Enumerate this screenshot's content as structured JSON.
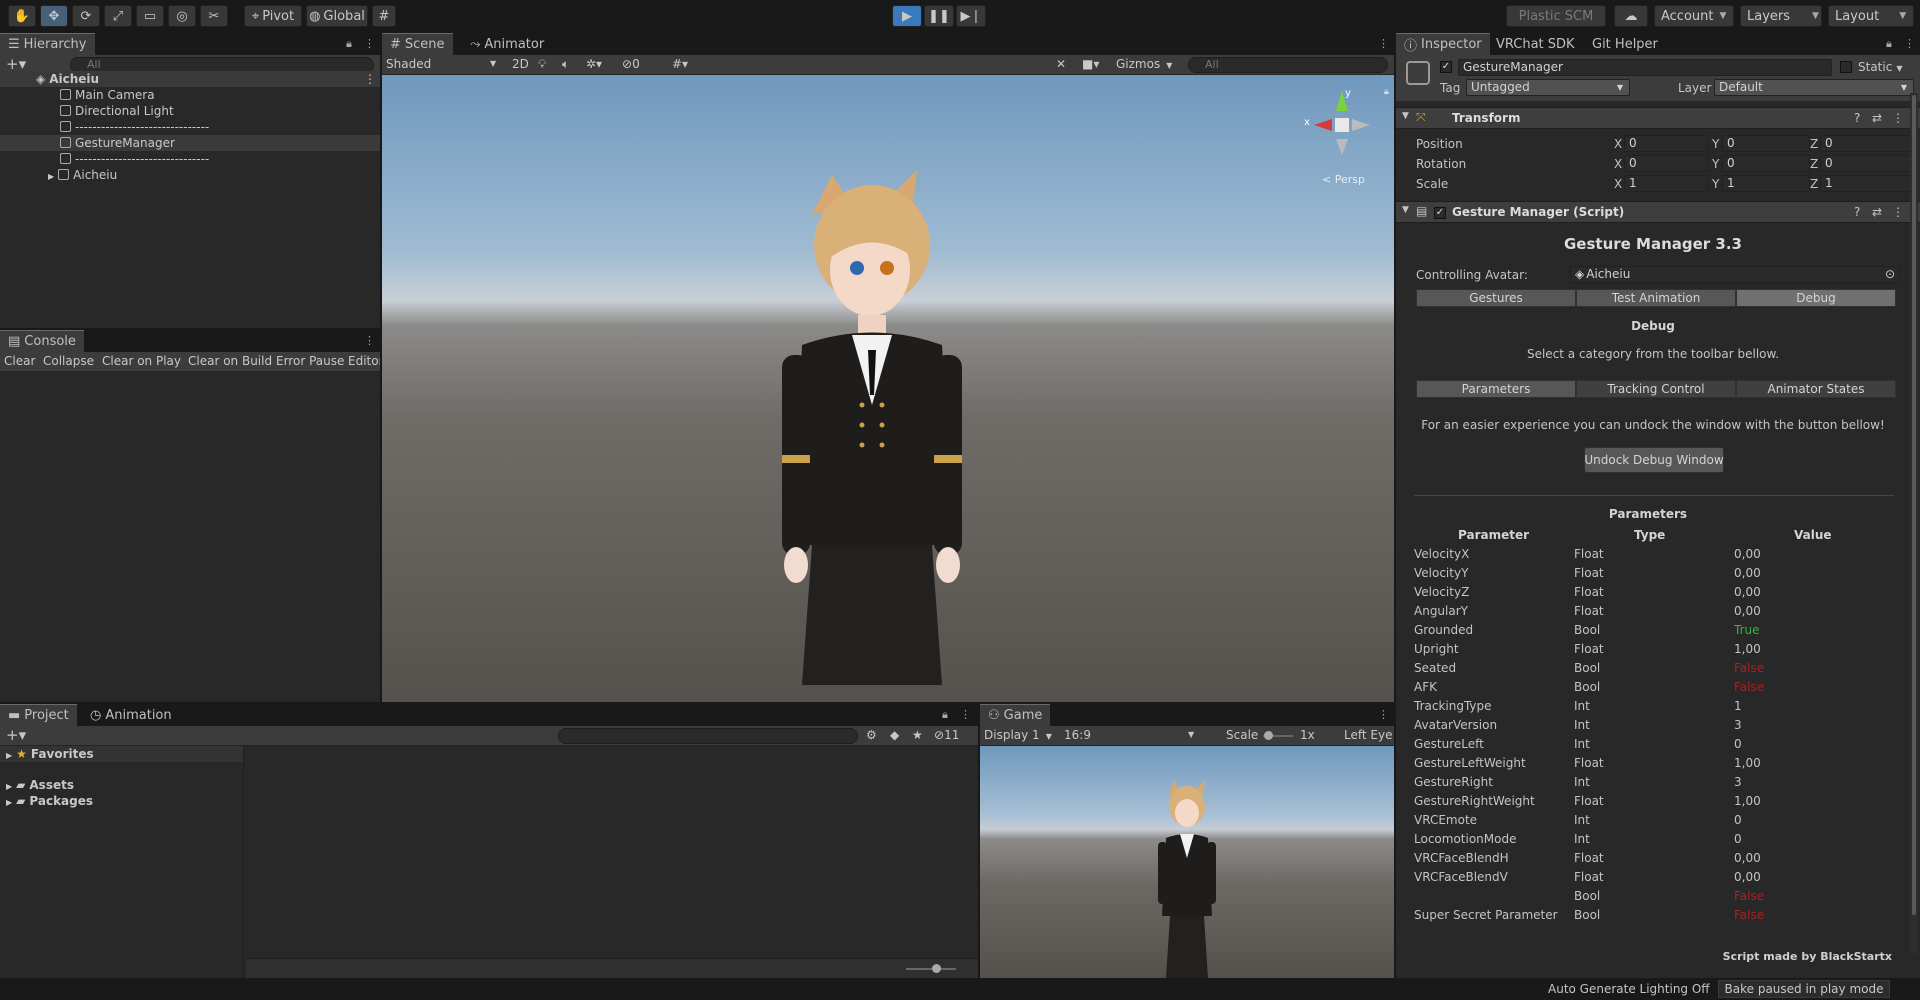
{
  "toolbar": {
    "pivot": "Pivot",
    "global": "Global",
    "plastic": "Plastic SCM",
    "account": "Account",
    "layers": "Layers",
    "layout": "Layout"
  },
  "hierarchy": {
    "tab": "Hierarchy",
    "search": "All",
    "root": "Aicheiu",
    "items": [
      "Main Camera",
      "Directional Light",
      "-------------------------------",
      "GestureManager",
      "-------------------------------",
      "Aicheiu"
    ]
  },
  "console": {
    "tab": "Console",
    "buttons": [
      "Clear",
      "Collapse",
      "Clear on Play",
      "Clear on Build",
      "Error Pause",
      "Editor"
    ]
  },
  "scene": {
    "tab": "Scene",
    "tab2": "Animator",
    "shading": "Shaded",
    "mode2d": "2D",
    "hidden_count": "0",
    "gizmos": "Gizmos",
    "search": "All",
    "persp": "Persp",
    "axis_y": "y",
    "axis_x": "x"
  },
  "project": {
    "tab": "Project",
    "tab2": "Animation",
    "favorites": "Favorites",
    "assets": "Assets",
    "packages": "Packages",
    "count": "11"
  },
  "game": {
    "tab": "Game",
    "display": "Display 1",
    "aspect": "16:9",
    "scale_label": "Scale",
    "scale_value": "1x",
    "eye": "Left Eye"
  },
  "inspector": {
    "tab": "Inspector",
    "tab2": "VRChat SDK",
    "tab3": "Git Helper",
    "object_name": "GestureManager",
    "static": "Static",
    "tag_label": "Tag",
    "tag_value": "Untagged",
    "layer_label": "Layer",
    "layer_value": "Default",
    "transform": {
      "title": "Transform",
      "rows": [
        {
          "label": "Position",
          "x": "0",
          "y": "0",
          "z": "0"
        },
        {
          "label": "Rotation",
          "x": "0",
          "y": "0",
          "z": "0"
        },
        {
          "label": "Scale",
          "x": "1",
          "y": "1",
          "z": "1"
        }
      ]
    },
    "script": {
      "title": "Gesture Manager (Script)",
      "heading": "Gesture Manager 3.3",
      "avatar_label": "Controlling Avatar:",
      "avatar_value": "Aicheiu",
      "tabs": [
        "Gestures",
        "Test Animation",
        "Debug"
      ],
      "debug_title": "Debug",
      "debug_hint": "Select a category from the toolbar bellow.",
      "subtabs": [
        "Parameters",
        "Tracking Control",
        "Animator States"
      ],
      "undock_hint": "For an easier experience you can undock the window with the button bellow!",
      "undock_button": "Undock Debug Window",
      "params_title": "Parameters",
      "col_param": "Parameter",
      "col_type": "Type",
      "col_value": "Value",
      "params": [
        {
          "name": "VelocityX",
          "type": "Float",
          "value": "0,00",
          "color": "#c4c4c4"
        },
        {
          "name": "VelocityY",
          "type": "Float",
          "value": "0,00",
          "color": "#c4c4c4"
        },
        {
          "name": "VelocityZ",
          "type": "Float",
          "value": "0,00",
          "color": "#c4c4c4"
        },
        {
          "name": "AngularY",
          "type": "Float",
          "value": "0,00",
          "color": "#c4c4c4"
        },
        {
          "name": "Grounded",
          "type": "Bool",
          "value": "True",
          "color": "#3fae3f"
        },
        {
          "name": "Upright",
          "type": "Float",
          "value": "1,00",
          "color": "#c4c4c4"
        },
        {
          "name": "Seated",
          "type": "Bool",
          "value": "False",
          "color": "#b01e1e"
        },
        {
          "name": "AFK",
          "type": "Bool",
          "value": "False",
          "color": "#b01e1e"
        },
        {
          "name": "TrackingType",
          "type": "Int",
          "value": "1",
          "color": "#c4c4c4"
        },
        {
          "name": "AvatarVersion",
          "type": "Int",
          "value": "3",
          "color": "#c4c4c4"
        },
        {
          "name": "GestureLeft",
          "type": "Int",
          "value": "0",
          "color": "#c4c4c4"
        },
        {
          "name": "GestureLeftWeight",
          "type": "Float",
          "value": "1,00",
          "color": "#c4c4c4"
        },
        {
          "name": "GestureRight",
          "type": "Int",
          "value": "3",
          "color": "#c4c4c4"
        },
        {
          "name": "GestureRightWeight",
          "type": "Float",
          "value": "1,00",
          "color": "#c4c4c4"
        },
        {
          "name": "VRCEmote",
          "type": "Int",
          "value": "0",
          "color": "#c4c4c4"
        },
        {
          "name": "LocomotionMode",
          "type": "Int",
          "value": "0",
          "color": "#c4c4c4"
        },
        {
          "name": "VRCFaceBlendH",
          "type": "Float",
          "value": "0,00",
          "color": "#c4c4c4"
        },
        {
          "name": "VRCFaceBlendV",
          "type": "Float",
          "value": "0,00",
          "color": "#c4c4c4"
        },
        {
          "name": "",
          "type": "Bool",
          "value": "False",
          "color": "#b01e1e"
        },
        {
          "name": "Super Secret Parameter",
          "type": "Bool",
          "value": "False",
          "color": "#b01e1e"
        }
      ],
      "credit": "Script made by BlackStartx"
    }
  },
  "status": {
    "lighting": "Auto Generate Lighting Off",
    "bake": "Bake paused in play mode"
  }
}
